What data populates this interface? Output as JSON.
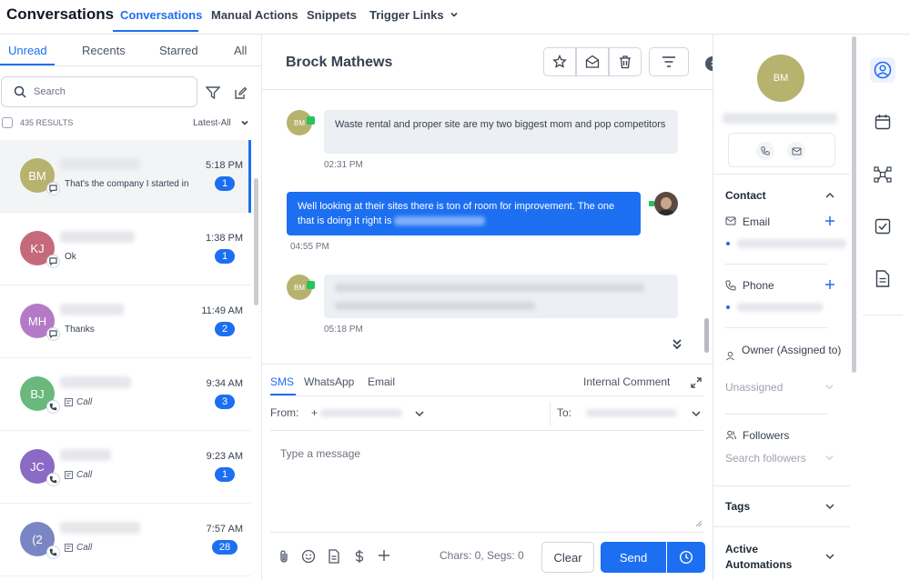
{
  "topnav": {
    "title": "Conversations",
    "items": [
      "Conversations",
      "Manual Actions",
      "Snippets",
      "Trigger Links"
    ]
  },
  "left": {
    "tabs": [
      "Unread",
      "Recents",
      "Starred",
      "All"
    ],
    "search_placeholder": "Search",
    "results": "435 RESULTS",
    "sort": "Latest-All",
    "conversations": [
      {
        "initials": "BM",
        "preview": "That's the company I started in",
        "time": "5:18 PM",
        "count": "1",
        "color": "#b5b36e",
        "type": "sms"
      },
      {
        "initials": "KJ",
        "preview": "Ok",
        "time": "1:38 PM",
        "count": "1",
        "color": "#c46a7a",
        "type": "sms"
      },
      {
        "initials": "MH",
        "preview": "Thanks",
        "time": "11:49 AM",
        "count": "2",
        "color": "#b57ac7",
        "type": "sms"
      },
      {
        "initials": "BJ",
        "preview": "Call",
        "time": "9:34 AM",
        "count": "3",
        "color": "#6ab87e",
        "type": "call"
      },
      {
        "initials": "JC",
        "preview": "Call",
        "time": "9:23 AM",
        "count": "1",
        "color": "#8a6ac4",
        "type": "call"
      },
      {
        "initials": "(2",
        "preview": "Call",
        "time": "7:57 AM",
        "count": "28",
        "color": "#7a86c4",
        "type": "call"
      }
    ]
  },
  "mid": {
    "contact_name": "Brock Mathews",
    "messages": [
      {
        "text": "Waste rental and proper site are my two biggest mom and pop competitors",
        "time": "02:31 PM",
        "avatar": "BM"
      },
      {
        "text": "Well looking at their sites there is ton of room for improvement. The one that is doing it right is",
        "time": "04:55 PM"
      },
      {
        "time": "05:18 PM",
        "avatar": "BM"
      }
    ],
    "composer": {
      "tabs": [
        "SMS",
        "WhatsApp",
        "Email"
      ],
      "internal_comment": "Internal Comment",
      "from_label": "From:",
      "from_prefix": "+",
      "to_label": "To:",
      "placeholder": "Type a message",
      "chars": "Chars: 0, Segs: 0",
      "clear": "Clear",
      "send": "Send"
    }
  },
  "right": {
    "avatar": "BM",
    "contact_title": "Contact",
    "email_label": "Email",
    "phone_label": "Phone",
    "owner_label": "Owner (Assigned to)",
    "owner_value": "Unassigned",
    "followers_label": "Followers",
    "followers_placeholder": "Search followers",
    "tags": "Tags",
    "active_automations": "Active Automations"
  },
  "colors": {
    "accent": "#1d6ff2",
    "avatar_bm": "#b5b36e"
  }
}
